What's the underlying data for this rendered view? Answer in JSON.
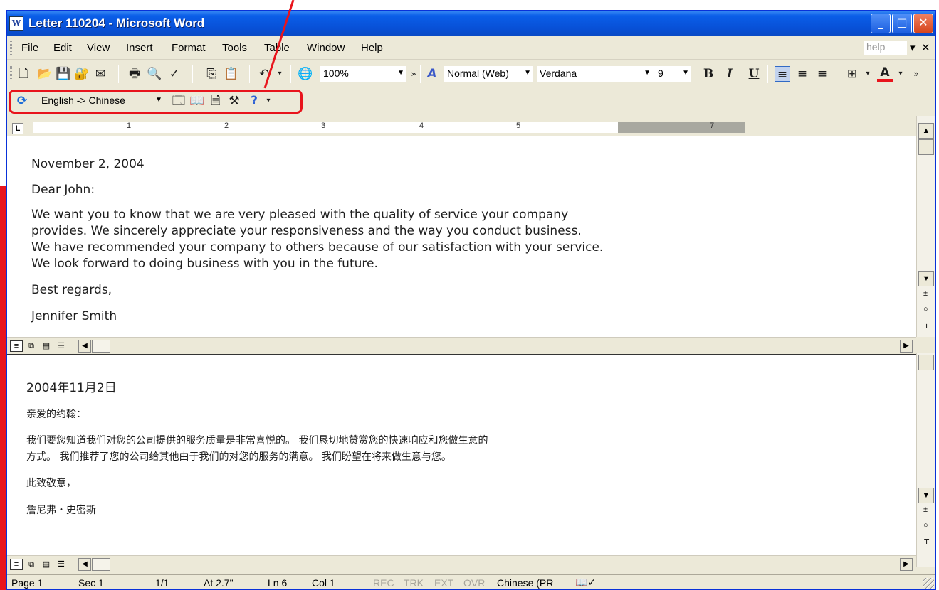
{
  "window": {
    "title": "Letter 110204 - Microsoft Word",
    "app_icon": "W",
    "controls": {
      "minimize": "_",
      "maximize": "□",
      "close": "✕"
    },
    "title_bar_color": "#0a5ee8",
    "annotation_color": "#e8141c"
  },
  "menu": {
    "items": [
      "File",
      "Edit",
      "View",
      "Insert",
      "Format",
      "Tools",
      "Table",
      "Window",
      "Help"
    ],
    "help_placeholder": "help",
    "help_dropdown": "▾",
    "close_doc": "✕"
  },
  "toolbar": {
    "icons": [
      "new-document-icon",
      "open-folder-icon",
      "save-disk-icon",
      "permission-icon",
      "email-icon",
      "print-icon",
      "print-preview-icon",
      "spelling-icon",
      "copy-icon",
      "paste-icon",
      "undo-icon",
      "web-globe-icon"
    ],
    "zoom": "100%",
    "overflow": "»",
    "style": "Normal (Web)",
    "font": "Verdana",
    "font_size": "9",
    "bold": "B",
    "italic": "I",
    "underline": "U",
    "font_color_label": "A",
    "font_color": "#e8141c"
  },
  "translation_toolbar": {
    "direction": "English -> Chinese",
    "icons": [
      "translate-logo-icon",
      "properties-icon",
      "dictionary-icon",
      "translate-document-icon",
      "tools-icon",
      "help-question-icon"
    ]
  },
  "ruler": {
    "numbers": [
      "1",
      "2",
      "3",
      "4",
      "5",
      "7"
    ]
  },
  "english_doc": {
    "date": "November 2, 2004",
    "salutation": "Dear John:",
    "body": [
      "We want you to know that we are very pleased with the quality of service your company",
      "provides. We sincerely appreciate your responsiveness and the way you conduct business.",
      "We have recommended your company to others because of our satisfaction with your service.",
      "We look forward to doing business with you in the future."
    ],
    "closing": "Best regards,",
    "signature": "Jennifer Smith"
  },
  "chinese_doc": {
    "date": "2004年11月2日",
    "salutation": "亲爱的约翰：",
    "body": [
      "我们要您知道我们对您的公司提供的服务质量是非常喜悦的。 我们恳切地赞赏您的快速响应和您做生意的",
      "方式。 我们推荐了您的公司给其他由于我们的对您的服务的满意。 我们盼望在将来做生意与您。"
    ],
    "closing": "此致敬意，",
    "signature": "詹尼弗・史密斯"
  },
  "status": {
    "page": "Page 1",
    "section": "Sec 1",
    "pages": "1/1",
    "at": "At 2.7\"",
    "line": "Ln 6",
    "col": "Col 1",
    "rec": "REC",
    "trk": "TRK",
    "ext": "EXT",
    "ovr": "OVR",
    "language": "Chinese (PR",
    "spelling_icon": "book-check-icon"
  }
}
